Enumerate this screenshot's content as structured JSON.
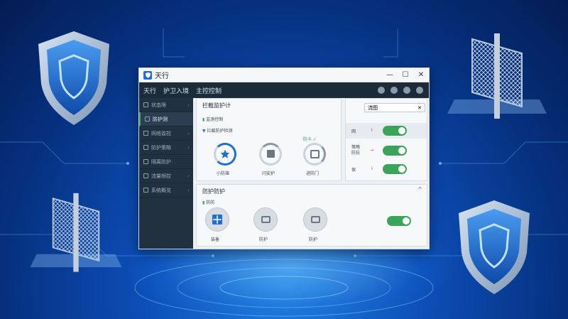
{
  "window": {
    "title": "天行"
  },
  "topnav": {
    "items": [
      "天行",
      "护卫入境",
      "主控控制"
    ]
  },
  "sidebar": {
    "items": [
      {
        "label": "状态限"
      },
      {
        "label": "防护测"
      },
      {
        "label": "网络监控"
      },
      {
        "label": "防护策略"
      },
      {
        "label": "隔离防护"
      },
      {
        "label": "流量频控"
      },
      {
        "label": "系统概览"
      }
    ]
  },
  "scan_card": {
    "title": "拦截监护计",
    "status": "监测控制",
    "sub": "拦截防护检测",
    "gauges": [
      {
        "label": "小防雄",
        "top": ""
      },
      {
        "label": "闪安护",
        "top": ""
      },
      {
        "label": "进防门",
        "top": "防卡 ✓"
      }
    ]
  },
  "settings_card": {
    "dropdown": "流图",
    "rows": [
      {
        "label": "网",
        "mark": "i"
      },
      {
        "label": "策略\n防抗",
        "mark": "→"
      },
      {
        "label": "保",
        "mark": "i"
      }
    ]
  },
  "protect_card": {
    "title": "防护防护",
    "status": "防防",
    "buttons": [
      {
        "label": "装备"
      },
      {
        "label": "防护"
      },
      {
        "label": "防护"
      }
    ]
  },
  "colors": {
    "accent": "#1f6fd6",
    "ok": "#3aa45a",
    "dark": "#1d2a37"
  }
}
